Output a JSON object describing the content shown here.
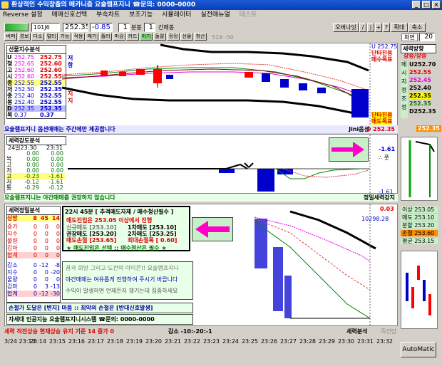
{
  "title": "환상적인 수익창출의 메카니즘 요술램프지니 ☎문의: 0000-0000",
  "window_buttons": [
    "_",
    "□",
    "×"
  ],
  "menu": [
    "Reverse 설정",
    "매매신호선택",
    "부속차트",
    "보조기능",
    "시뮬레이터",
    "실전매뉴얼",
    "테스트"
  ],
  "toolbar": {
    "code": "101J6",
    "price": "252.35",
    "change": "-0.85",
    "minutes_a": "1",
    "minutes_a_label": "분봉",
    "minutes_b": "1",
    "minutes_b_label": "간매봉",
    "mode_tabs": [
      "버퍼",
      "경보",
      "다소",
      "멀티",
      "가능",
      "적용",
      "매기",
      "플러",
      "마감",
      "카드",
      "아기",
      "돌팔",
      "정정",
      "선물",
      "청산"
    ],
    "extra": "519 -50",
    "top_right_buttons": [
      "오버나잇",
      "/",
      "|",
      "+",
      "?",
      "확대",
      "축소"
    ],
    "screen_label": "화면",
    "screen_value": "20",
    "right_labels": [
      "위치",
      "상승",
      "상승",
      "분석"
    ]
  },
  "futures_panel": {
    "header": "선물지수분석",
    "rows": [
      {
        "label": "U",
        "a": "252.75",
        "b": "252.75"
      },
      {
        "label": "청",
        "a": "252.65",
        "b": "252.60"
      },
      {
        "label": "고",
        "a": "252.60",
        "b": "252.60"
      },
      {
        "label": "시",
        "a": "252.60",
        "b": "252.55"
      },
      {
        "label": "종",
        "a": "252.55",
        "b": "252.55"
      },
      {
        "label": "저",
        "a": "252.50",
        "b": "252.35"
      },
      {
        "label": "종",
        "a": "252.40",
        "b": "252.55"
      },
      {
        "label": "봉",
        "a": "252.40",
        "b": "252.55"
      },
      {
        "label": "D",
        "a": "252.35",
        "b": "252.35"
      },
      {
        "label": "목",
        "a": "0.37",
        "b": "0.37"
      }
    ],
    "side_tags": [
      "저",
      "항",
      "지",
      "지"
    ],
    "labels_right": [
      "U 252.75",
      "단타진용",
      "매수목표"
    ],
    "labels_right_bottom": [
      "단타진용",
      "매도목표",
      "D 252.35"
    ],
    "notice": "요술램프지니 옵션매매는 주간에만 제공합니다",
    "notice_right": "Jini옵션"
  },
  "right_panel": {
    "header": "세력방향",
    "subheader": "상승/상승",
    "level_labels": [
      "메",
      "시",
      "지",
      "정",
      "조",
      "정"
    ],
    "levels": [
      "U252.70",
      "252.55",
      "252.45",
      "252.40",
      "252.35",
      "252.35",
      "D252.35"
    ],
    "badge": "252.35",
    "badge2": "252.35"
  },
  "power_panel": {
    "header": "세력강도분석",
    "date": "24일23:30",
    "time": "23:31",
    "rows": [
      {
        "label": "",
        "a": "0.00",
        "b": "0.00"
      },
      {
        "label": "복",
        "a": "0.00",
        "b": "0.00"
      },
      {
        "label": "고",
        "a": "0.00",
        "b": "0.00"
      },
      {
        "label": "저",
        "a": "0.00",
        "b": "0.00"
      },
      {
        "label": "고",
        "a": "-0.23",
        "b": "-1.61"
      },
      {
        "label": "저",
        "a": "-0.12",
        "b": "-1.61"
      },
      {
        "label": "통",
        "a": "-0.29",
        "b": "-0.12"
      }
    ],
    "right_value": "-1.61",
    "right_value2": "-1.61",
    "right_header": "야간옵션",
    "right_sub": "∴ 풋",
    "notice": "요술램프지니는 야간매매를 권장하지 않습니다",
    "notice_right": "정밀세력강지"
  },
  "trend_panel": {
    "header": "세력정밀분석",
    "cols": [
      "상방",
      "8",
      "45",
      "14"
    ],
    "rows": [
      {
        "label": "증가",
        "a": "0",
        "b": "0",
        "c": "0"
      },
      {
        "label": "지수",
        "a": "0",
        "b": "0",
        "c": "0"
      },
      {
        "label": "물량",
        "a": "0",
        "b": "0",
        "c": "0"
      },
      {
        "label": "감마",
        "a": "0",
        "b": "0",
        "c": "0"
      },
      {
        "label": "합계",
        "a": "0",
        "b": "0",
        "c": "0"
      }
    ],
    "rows2": [
      {
        "label": "감소",
        "a": "0",
        "b": "-12",
        "c": "-8"
      },
      {
        "label": "지수",
        "a": "0",
        "b": "0",
        "c": "-20"
      },
      {
        "label": "물량",
        "a": "0",
        "b": "0",
        "c": "0"
      },
      {
        "label": "감마",
        "a": "0",
        "b": "3",
        "c": "-13"
      },
      {
        "label": "합계",
        "a": "0",
        "b": "-12",
        "c": "-30"
      }
    ]
  },
  "signal_box": {
    "time_line": "22시 45분 [ 추격매도자제 / 매수청산필수 ]",
    "line1": "매도진입은 253.05 이상에서 진행",
    "items": [
      [
        "신규매도 [253.10]",
        "1차매도 [253.10]"
      ],
      [
        "권장매도 [253.20]",
        "2차매도 [253.25]"
      ],
      [
        "매도손절 [253.65]",
        "최대손절폭 [ 0.60]"
      ]
    ],
    "footer": "★ 매도진입은 선택  ::  매수청산은 필수 ★"
  },
  "message_box": {
    "line1": "꿈과 희망 그리고 도전의 아이콘!! 요술램프지니",
    "line2": "야간매매는 여유롭게 진행하여 주시기 바랍니다",
    "line3": "수익이 발생하면 언제든지 챙기는데 집중하세요"
  },
  "stop_note": "손절가 도달은 [변지] 마음 :: 최악의 손절은 [반대신호발생]",
  "contact": "자세대 인공지능 요술램프지니시스템 ☎문의: 0000-0000",
  "bottom_right_values": {
    "top": "0.03",
    "second": "10298.28",
    "list": [
      "이상 253.05",
      "매도 253.10",
      "분할 253.20",
      "손절 253.60",
      "평균 253.15"
    ]
  },
  "status_bar": {
    "left": "세력 적전상승 현재상승 유지 기준 14 증가 0",
    "mid": "감소 -10:-20:-1",
    "right": "세력분석",
    "extra": "즉전망"
  },
  "time_axis": [
    "3/24 23:13",
    "23:14",
    "23:15",
    "23:16",
    "23:17",
    "23:18",
    "23:19",
    "23:20",
    "23:21",
    "23:22",
    "23:23",
    "23:24",
    "23:25",
    "23:26",
    "23:27",
    "23:28",
    "23:29",
    "23:30",
    "23:31",
    "23:32"
  ],
  "automatic_button": "AutoMatic",
  "colors": {
    "accent_blue": "#1b5bd6",
    "up_red": "#e00000",
    "down_blue": "#0000cc",
    "signal_magenta": "#ff00c8",
    "panel_green": "#c8f0c8"
  }
}
